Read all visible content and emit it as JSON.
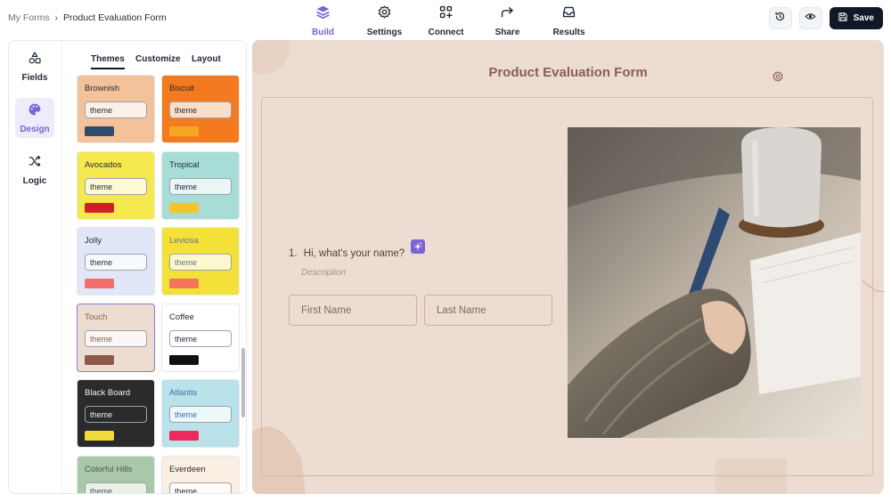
{
  "breadcrumb": {
    "root": "My Forms",
    "separator": "›",
    "current": "Product Evaluation Form"
  },
  "nav": {
    "tabs": [
      {
        "label": "Build",
        "icon": "layers-icon",
        "active": true
      },
      {
        "label": "Settings",
        "icon": "gear-icon",
        "active": false
      },
      {
        "label": "Connect",
        "icon": "grid-plus-icon",
        "active": false
      },
      {
        "label": "Share",
        "icon": "share-arrow-icon",
        "active": false
      },
      {
        "label": "Results",
        "icon": "inbox-icon",
        "active": false
      }
    ]
  },
  "actions": {
    "history_icon": "history-icon",
    "preview_icon": "eye-icon",
    "save_label": "Save"
  },
  "sidebar": {
    "rail": [
      {
        "label": "Fields",
        "icon": "shapes-icon",
        "active": false
      },
      {
        "label": "Design",
        "icon": "palette-icon",
        "active": true
      },
      {
        "label": "Logic",
        "icon": "shuffle-icon",
        "active": false
      }
    ],
    "subtabs": [
      {
        "label": "Themes",
        "active": true
      },
      {
        "label": "Customize",
        "active": false
      },
      {
        "label": "Layout",
        "active": false
      }
    ],
    "themes": [
      {
        "name": "Brownish",
        "pill": "theme",
        "bg": "#f3c19a",
        "bar": "#2f4a6b",
        "text": "#1f2937"
      },
      {
        "name": "Biscuit",
        "pill": "theme",
        "bg": "#f47a1f",
        "bar": "#f4a71f",
        "text": "#1f2937"
      },
      {
        "name": "Avocados",
        "pill": "theme",
        "bg": "#f5e94f",
        "bar": "#d21f26",
        "text": "#1f2937"
      },
      {
        "name": "Tropical",
        "pill": "theme",
        "bg": "#a8dcd6",
        "bar": "#f6c32a",
        "text": "#1f2937"
      },
      {
        "name": "Jolly",
        "pill": "theme",
        "bg": "#e1e7f8",
        "bar": "#f26d6d",
        "text": "#1f2937"
      },
      {
        "name": "Leviosa",
        "pill": "theme",
        "bg": "#f3e13a",
        "bar": "#f6745b",
        "text": "#6b7280"
      },
      {
        "name": "Touch",
        "pill": "theme",
        "bg": "#ecdcd1",
        "bar": "#8b5a4a",
        "text": "#8a6052",
        "selected": true
      },
      {
        "name": "Coffee",
        "pill": "theme",
        "bg": "#ffffff",
        "bar": "#111111",
        "text": "#1f2937"
      },
      {
        "name": "Black Board",
        "pill": "theme",
        "bg": "#2b2b2b",
        "bar": "#f2d93a",
        "text": "#f3f4f6"
      },
      {
        "name": "Atlantis",
        "pill": "theme",
        "bg": "#b9e2ea",
        "bar": "#ee2a5a",
        "text": "#3a6fb0"
      },
      {
        "name": "Colorful Hills",
        "pill": "theme",
        "bg": "#a9c8a9",
        "bar": "#ffffff",
        "text": "#4b5563"
      },
      {
        "name": "Everdeen",
        "pill": "theme",
        "bg": "#fbeee2",
        "bar": "#ffffff",
        "text": "#1f2937"
      }
    ]
  },
  "form": {
    "title": "Product Evaluation Form",
    "question": {
      "number": "1.",
      "label": "Hi, what's your name?",
      "description": "Description"
    },
    "fields": [
      {
        "placeholder": "First Name"
      },
      {
        "placeholder": "Last Name"
      }
    ]
  },
  "colors": {
    "accent": "#7c63d6",
    "canvas_bg": "#ecdcd1",
    "title": "#8a6052",
    "save_bg": "#111827"
  }
}
